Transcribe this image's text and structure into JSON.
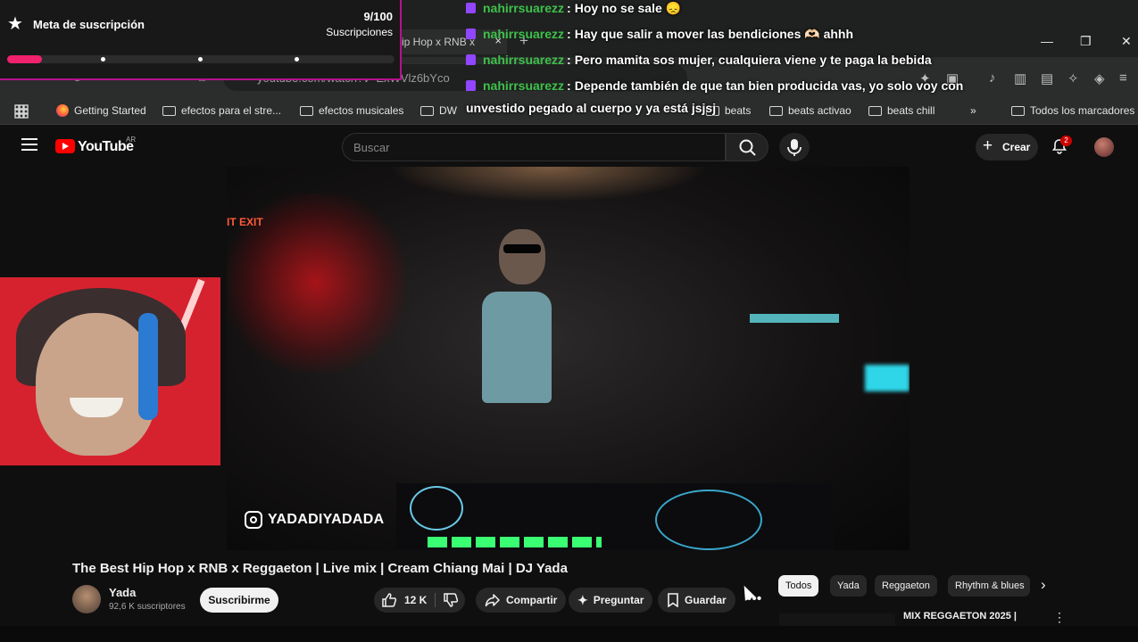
{
  "browser": {
    "tab_title": "ip Hop x RNB x",
    "tab_close": "×",
    "new_tab": "+",
    "url": "youtube.com/watch?v=ExWVlz6bYco",
    "window_controls": {
      "minimize": "—",
      "restore": "❐",
      "close": "✕"
    },
    "bookmarks": [
      {
        "label": "Getting Started",
        "icon": "firefox-icon"
      },
      {
        "label": "efectos para el stre...",
        "icon": "folder-icon"
      },
      {
        "label": "efectos musicales",
        "icon": "folder-icon"
      },
      {
        "label": "DW",
        "icon": "folder-icon"
      },
      {
        "label": "beats",
        "icon": "folder-icon"
      },
      {
        "label": "beats activao",
        "icon": "folder-icon"
      },
      {
        "label": "beats chill",
        "icon": "folder-icon"
      }
    ],
    "bookmarks_overflow": "»",
    "all_bookmarks": "Todos los marcadores"
  },
  "youtube": {
    "logo_text": "YouTube",
    "region": "AR",
    "search_placeholder": "Buscar",
    "create_label": "Crear",
    "notifications_count": "2"
  },
  "video": {
    "exit_sign": "IT EXIT",
    "instagram_handle": "YADADIYADADA",
    "title": "The Best Hip Hop x RNB x Reggaeton | Live mix | Cream Chiang Mai | DJ Yada",
    "channel_name": "Yada",
    "channel_subs": "92,6 K suscriptores",
    "subscribe_label": "Suscribirme",
    "likes": "12 K",
    "share_label": "Compartir",
    "ask_label": "Preguntar",
    "save_label": "Guardar",
    "more": "•••"
  },
  "chips": {
    "items": [
      "Todos",
      "Yada",
      "Reggaeton",
      "Rhythm & blues"
    ],
    "next": "›"
  },
  "recommendation": {
    "title": "MIX REGGAETON 2025 |",
    "menu": "⋮"
  },
  "sub_goal": {
    "title": "Meta de suscripción",
    "count": "9/100",
    "unit": "Suscripciones",
    "progress": 0.09,
    "star": "★"
  },
  "chat": [
    {
      "user": "nahirrsuarezz",
      "message": "Hoy no se sale 😞"
    },
    {
      "user": "nahirrsuarezz",
      "message": "Hay que salir a mover las bendiciones 🫶🏻 ahhh"
    },
    {
      "user": "nahirrsuarezz",
      "message": "Pero mamita sos mujer, cualquiera viene y te paga la bebida"
    },
    {
      "user": "nahirrsuarezz",
      "message": "Depende también de que tan bien producida vas, yo solo voy con"
    }
  ],
  "chat_wrap": "unvestido pegado al cuerpo y ya está jsjsj",
  "colors": {
    "chat_user": "#3ec04b",
    "goal_fill": "#f0216d",
    "goal_border": "#b5128e",
    "yt_red": "#ff0000"
  }
}
